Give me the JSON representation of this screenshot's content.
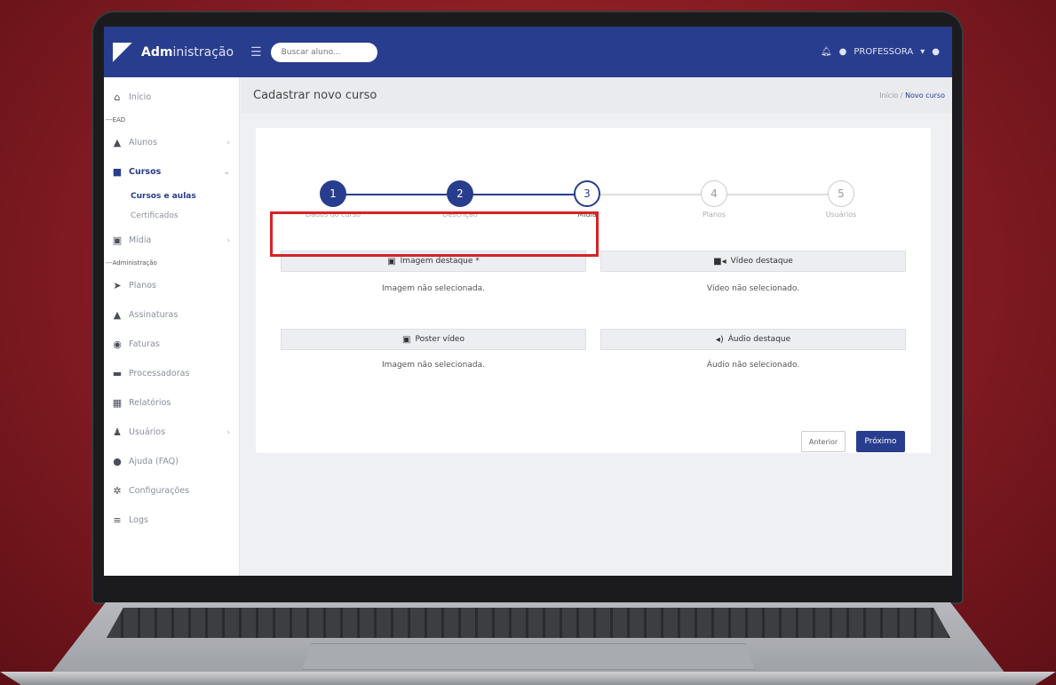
{
  "app": {
    "brand_bold": "Adm",
    "brand_rest": "inistração",
    "search_placeholder": "Buscar aluno...",
    "user_label": "PROFESSORA"
  },
  "page": {
    "title": "Cadastrar novo curso",
    "breadcrumb_home": "Início",
    "breadcrumb_current": "Novo curso"
  },
  "sidebar": {
    "inicio": "Início",
    "sec_ead": "EAD",
    "alunos": "Alunos",
    "cursos": "Cursos",
    "cursos_aulas": "Cursos e aulas",
    "certificados": "Certificados",
    "midia": "Mídia",
    "sec_admin": "Administração",
    "planos": "Planos",
    "assinaturas": "Assinaturas",
    "faturas": "Faturas",
    "processadoras": "Processadoras",
    "relatorios": "Relatórios",
    "usuarios": "Usuários",
    "ajuda": "Ajuda (FAQ)",
    "configuracoes": "Configurações",
    "logs": "Logs"
  },
  "steps": [
    {
      "num": "1",
      "label": "Dados do curso"
    },
    {
      "num": "2",
      "label": "Descrição"
    },
    {
      "num": "3",
      "label": "Mídia"
    },
    {
      "num": "4",
      "label": "Planos"
    },
    {
      "num": "5",
      "label": "Usuários"
    }
  ],
  "media": {
    "imagem_btn": "Imagem destaque *",
    "imagem_status": "Imagem não selecionada.",
    "video_btn": "Vídeo destaque",
    "video_status": "Vídeo não selecionado.",
    "poster_btn": "Poster vídeo",
    "poster_status": "Imagem não selecionada.",
    "audio_btn": "Áudio destaque",
    "audio_status": "Áudio não selecionado."
  },
  "nav": {
    "prev": "Anterior",
    "next": "Próximo"
  },
  "colors": {
    "primary": "#283d8e",
    "highlight": "#d42426",
    "background": "#8a1c22"
  }
}
